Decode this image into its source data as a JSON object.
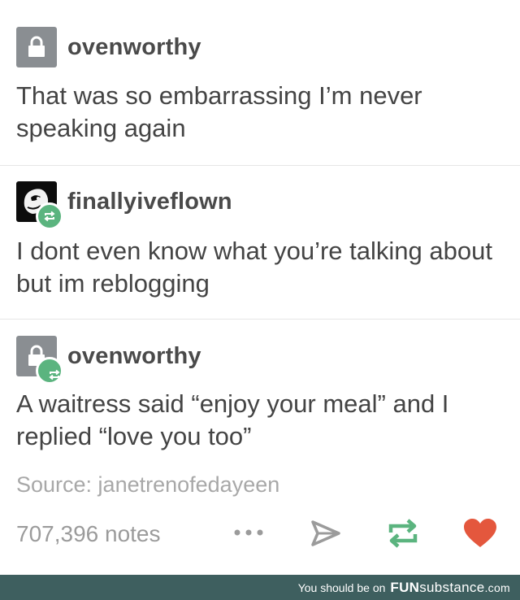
{
  "posts": [
    {
      "username": "ovenworthy",
      "avatar": "lock-icon",
      "reblogged": false,
      "text": "That was so embarrassing I’m never speaking again"
    },
    {
      "username": "finallyiveflown",
      "avatar": "bird-avatar",
      "reblogged": true,
      "text": "I dont even know what you’re talking about but im reblogging"
    },
    {
      "username": "ovenworthy",
      "avatar": "lock-icon",
      "reblogged": true,
      "text": "A waitress said “enjoy your meal” and I replied “love you too”"
    }
  ],
  "source": "Source: janetrenofedayeen",
  "notes": "707,396 notes",
  "actions": [
    "more-icon",
    "share-icon",
    "reblog-icon",
    "like-icon"
  ],
  "banner": {
    "text": "You should be on",
    "brand_bold": "FUN",
    "brand_rest": "substance",
    "brand_tld": ".com"
  },
  "colors": {
    "reblog_green": "#5bb47f",
    "like_red": "#e4573d",
    "banner_bg": "#3e5f5f"
  }
}
